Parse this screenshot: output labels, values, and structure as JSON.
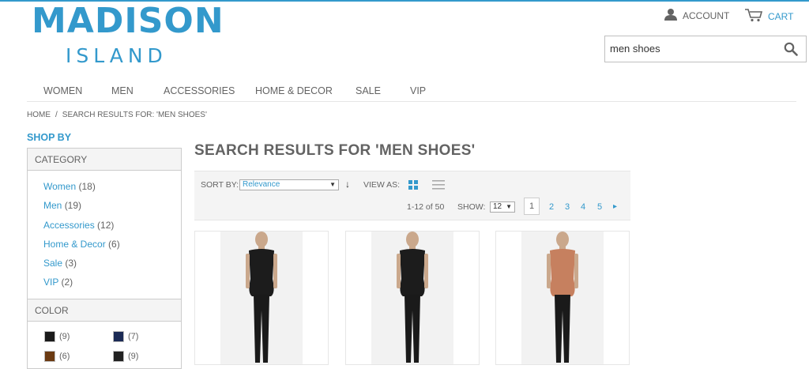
{
  "brand": {
    "line1": "MADISON",
    "line2": "ISLAND"
  },
  "header": {
    "account_label": "ACCOUNT",
    "cart_label": "CART"
  },
  "search": {
    "value": "men shoes"
  },
  "nav": {
    "items": [
      "WOMEN",
      "MEN",
      "ACCESSORIES",
      "HOME & DECOR",
      "SALE",
      "VIP"
    ]
  },
  "breadcrumb": {
    "home": "HOME",
    "sep": "/",
    "current": "SEARCH RESULTS FOR: 'MEN SHOES'"
  },
  "sidebar": {
    "shop_by": "SHOP BY",
    "category_title": "CATEGORY",
    "categories": [
      {
        "label": "Women",
        "count": "(18)"
      },
      {
        "label": "Men",
        "count": "(19)"
      },
      {
        "label": "Accessories",
        "count": "(12)"
      },
      {
        "label": "Home & Decor",
        "count": "(6)"
      },
      {
        "label": "Sale",
        "count": "(3)"
      },
      {
        "label": "VIP",
        "count": "(2)"
      }
    ],
    "color_title": "COLOR",
    "colors": [
      {
        "hex": "#1a1a1a",
        "count": "(9)"
      },
      {
        "hex": "#1b2a55",
        "count": "(7)"
      },
      {
        "hex": "#6b3a12",
        "count": "(6)"
      },
      {
        "hex": "#222222",
        "count": "(9)"
      }
    ]
  },
  "results": {
    "title": "SEARCH RESULTS FOR 'MEN SHOES'",
    "sort_label": "SORT BY:",
    "sort_value": "Relevance",
    "sort_dir_glyph": "↓",
    "view_label": "VIEW AS:",
    "count_text": "1-12 of 50",
    "show_label": "SHOW:",
    "show_value": "12",
    "pages": [
      "1",
      "2",
      "3",
      "4",
      "5"
    ],
    "next_glyph": "▸"
  },
  "products": [
    {
      "name": "black-top-product",
      "top_color": "#1c1c1c"
    },
    {
      "name": "black-top-product",
      "top_color": "#1c1c1c"
    },
    {
      "name": "coral-top-product",
      "top_color": "#c6805f"
    }
  ],
  "colors": {
    "accent": "#3399cc",
    "text": "#636363",
    "border": "#cccccc",
    "panel": "#f4f4f4"
  }
}
